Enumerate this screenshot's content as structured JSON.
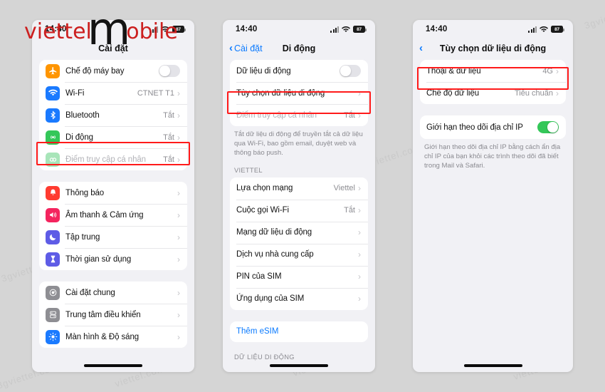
{
  "brand": {
    "part1": "viettel",
    "bigM": "m",
    "part2": "obile"
  },
  "watermarks": [
    "3gviettel.com",
    "3gviettel.com",
    "3gviettel",
    "viettel.com",
    "viettel.com",
    "viettel.com",
    "viettel.com",
    "viettel.com"
  ],
  "status": {
    "time": "14:40",
    "battery": "87",
    "signal_icon": "cellular-bars-icon",
    "wifi_icon": "wifi-icon",
    "battery_icon": "battery-icon"
  },
  "phone1": {
    "nav_title": "Cài đặt",
    "group1": [
      {
        "label": "Chế độ máy bay",
        "icon": "airplane-icon",
        "icon_color": "#ff9500",
        "control": "toggle",
        "toggle_on": false
      },
      {
        "label": "Wi-Fi",
        "icon": "wifi-icon",
        "icon_color": "#1a7aff",
        "value": "CTNET T1",
        "control": "chevron"
      },
      {
        "label": "Bluetooth",
        "icon": "bluetooth-icon",
        "icon_color": "#1a7aff",
        "value": "Tắt",
        "control": "chevron"
      },
      {
        "label": "Di động",
        "icon": "cellular-icon",
        "icon_color": "#34c759",
        "value": "Tắt",
        "control": "chevron",
        "highlighted": true
      },
      {
        "label": "Điểm truy cập cá nhân",
        "icon": "hotspot-icon",
        "icon_color": "#a8e5b9",
        "value": "Tắt",
        "control": "chevron",
        "dim": true
      }
    ],
    "group2": [
      {
        "label": "Thông báo",
        "icon": "notifications-icon",
        "icon_color": "#ff3b30",
        "control": "chevron"
      },
      {
        "label": "Âm thanh & Cảm ứng",
        "icon": "sound-icon",
        "icon_color": "#f4245e",
        "control": "chevron"
      },
      {
        "label": "Tập trung",
        "icon": "focus-moon-icon",
        "icon_color": "#5e5ce6",
        "control": "chevron"
      },
      {
        "label": "Thời gian sử dụng",
        "icon": "hourglass-icon",
        "icon_color": "#5e5ce6",
        "control": "chevron"
      }
    ],
    "group3": [
      {
        "label": "Cài đặt chung",
        "icon": "gear-icon",
        "icon_color": "#8e8e93",
        "control": "chevron"
      },
      {
        "label": "Trung tâm điều khiển",
        "icon": "control-center-icon",
        "icon_color": "#8e8e93",
        "control": "chevron"
      },
      {
        "label": "Màn hình & Độ sáng",
        "icon": "brightness-icon",
        "icon_color": "#1a7aff",
        "control": "chevron"
      }
    ]
  },
  "phone2": {
    "nav_back": "Cài đặt",
    "nav_title": "Di động",
    "group1": [
      {
        "label": "Dữ liệu di động",
        "control": "toggle",
        "toggle_on": false
      },
      {
        "label": "Tùy chọn dữ liệu di động",
        "control": "chevron",
        "highlighted": true
      },
      {
        "label": "Điểm truy cập cá nhân",
        "value": "Tắt",
        "control": "chevron",
        "dim": true
      }
    ],
    "footnote1": "Tắt dữ liệu di động để truyền tắt cả dữ liệu qua Wi-Fi, bao gồm email, duyệt web và thông báo push.",
    "section_header": "VIETTEL",
    "group2": [
      {
        "label": "Lựa chọn mạng",
        "value": "Viettel",
        "control": "chevron"
      },
      {
        "label": "Cuộc gọi Wi-Fi",
        "value": "Tắt",
        "control": "chevron"
      },
      {
        "label": "Mạng dữ liệu di động",
        "control": "chevron"
      },
      {
        "label": "Dịch vụ nhà cung cấp",
        "control": "chevron"
      },
      {
        "label": "PIN của SIM",
        "control": "chevron"
      },
      {
        "label": "Ứng dụng của SIM",
        "control": "chevron"
      }
    ],
    "group3": [
      {
        "label": "Thêm eSIM",
        "link": true
      }
    ],
    "section_header2": "DỮ LIỆU DI ĐỘNG"
  },
  "phone3": {
    "nav_title": "Tùy chọn dữ liệu di động",
    "group1": [
      {
        "label": "Thoại & dữ liệu",
        "value": "4G",
        "control": "chevron",
        "highlighted": true
      },
      {
        "label": "Chế độ dữ liệu",
        "value": "Tiêu chuẩn",
        "control": "chevron",
        "dim_value": true
      }
    ],
    "group2": [
      {
        "label": "Giới hạn theo dõi địa chỉ IP",
        "control": "toggle",
        "toggle_on": true
      }
    ],
    "footnote1": "Giới hạn theo dõi địa chỉ IP bằng cách ẩn địa chỉ IP của bạn khỏi các trình theo dõi đã biết trong Mail và Safari."
  }
}
